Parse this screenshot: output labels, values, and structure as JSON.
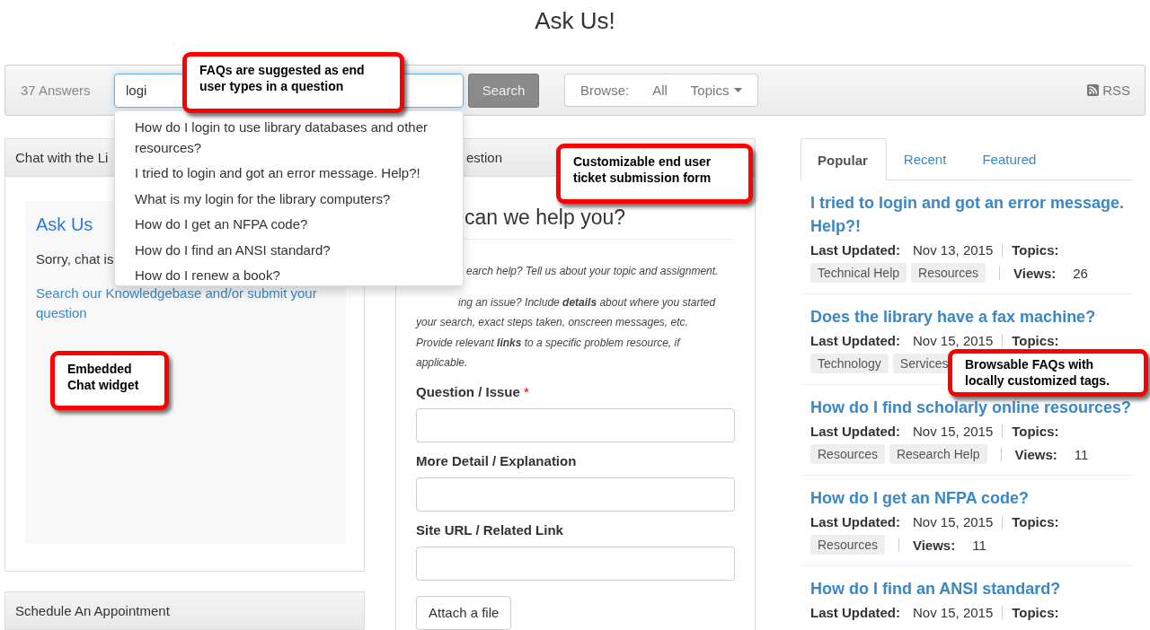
{
  "title": "Ask Us!",
  "toolbar": {
    "count": "37 Answers",
    "search": {
      "value": "logi"
    },
    "search_button": "Search",
    "browse": {
      "label": "Browse:",
      "links": [
        {
          "label": "All",
          "dropdown": false
        },
        {
          "label": "Topics",
          "dropdown": true
        }
      ]
    },
    "rss": "RSS"
  },
  "suggestions": [
    "How do I login to use library databases and other resources?",
    "I tried to login and got an error message. Help?!",
    "What is my login for the library computers?",
    "How do I get an NFPA code?",
    "How do I find an ANSI standard?",
    "How do I renew a book?"
  ],
  "chat_panel": {
    "header": "Chat with the Li",
    "heading": "Ask Us",
    "message": "Sorry, chat is",
    "link": "Search our Knowledgebase and/or submit your question"
  },
  "schedule_panel": {
    "header": "Schedule An Appointment"
  },
  "form_panel": {
    "header": "estion",
    "heading": "can we help you?",
    "intro": [
      "*earch help?* Tell us about your topic and assignment.",
      "*ing an issue?* Include **details** about where you started your search, exact steps taken, onscreen messages, etc. Provide relevant **links** to a specific problem resource, if applicable."
    ],
    "fields": [
      {
        "label": "Question / Issue",
        "required_mark": "*"
      },
      {
        "label": "More Detail / Explanation"
      },
      {
        "label": "Site URL / Related Link"
      }
    ],
    "attach_button": "Attach a file"
  },
  "faq": {
    "tabs": [
      {
        "label": "Popular",
        "selected": true
      },
      {
        "label": "Recent",
        "selected": false
      },
      {
        "label": "Featured",
        "selected": false
      }
    ],
    "items": [
      {
        "title": "I tried to login and got an error message. Help?!",
        "updated_label": "Last Updated:",
        "date": "Nov 13, 2015",
        "topics_label": "Topics:",
        "tags": [
          "Technical Help",
          "Resources"
        ],
        "views_label": "Views:",
        "views": "26"
      },
      {
        "title": "Does the library have a fax machine?",
        "updated_label": "Last Updated:",
        "date": "Nov 15, 2015",
        "topics_label": "Topics:",
        "tags": [
          "Technology",
          "Services"
        ]
      },
      {
        "title": "How do I find scholarly online resources?",
        "updated_label": "Last Updated:",
        "date": "Nov 15, 2015",
        "topics_label": "Topics:",
        "tags": [
          "Resources",
          "Research Help"
        ],
        "views_label": "Views:",
        "views": "11"
      },
      {
        "title": "How do I get an NFPA code?",
        "updated_label": "Last Updated:",
        "date": "Nov 15, 2015",
        "topics_label": "Topics:",
        "tags": [
          "Resources"
        ],
        "views_label": "Views:",
        "views": "11"
      },
      {
        "title": "How do I find an ANSI standard?",
        "updated_label": "Last Updated:",
        "date": "Nov 15, 2015",
        "topics_label": "Topics:"
      }
    ]
  },
  "callouts": [
    "FAQs are suggested as end user types in a question",
    "Customizable end user ticket submission form",
    "Embedded Chat widget",
    "Browsable FAQs with locally customized tags."
  ]
}
